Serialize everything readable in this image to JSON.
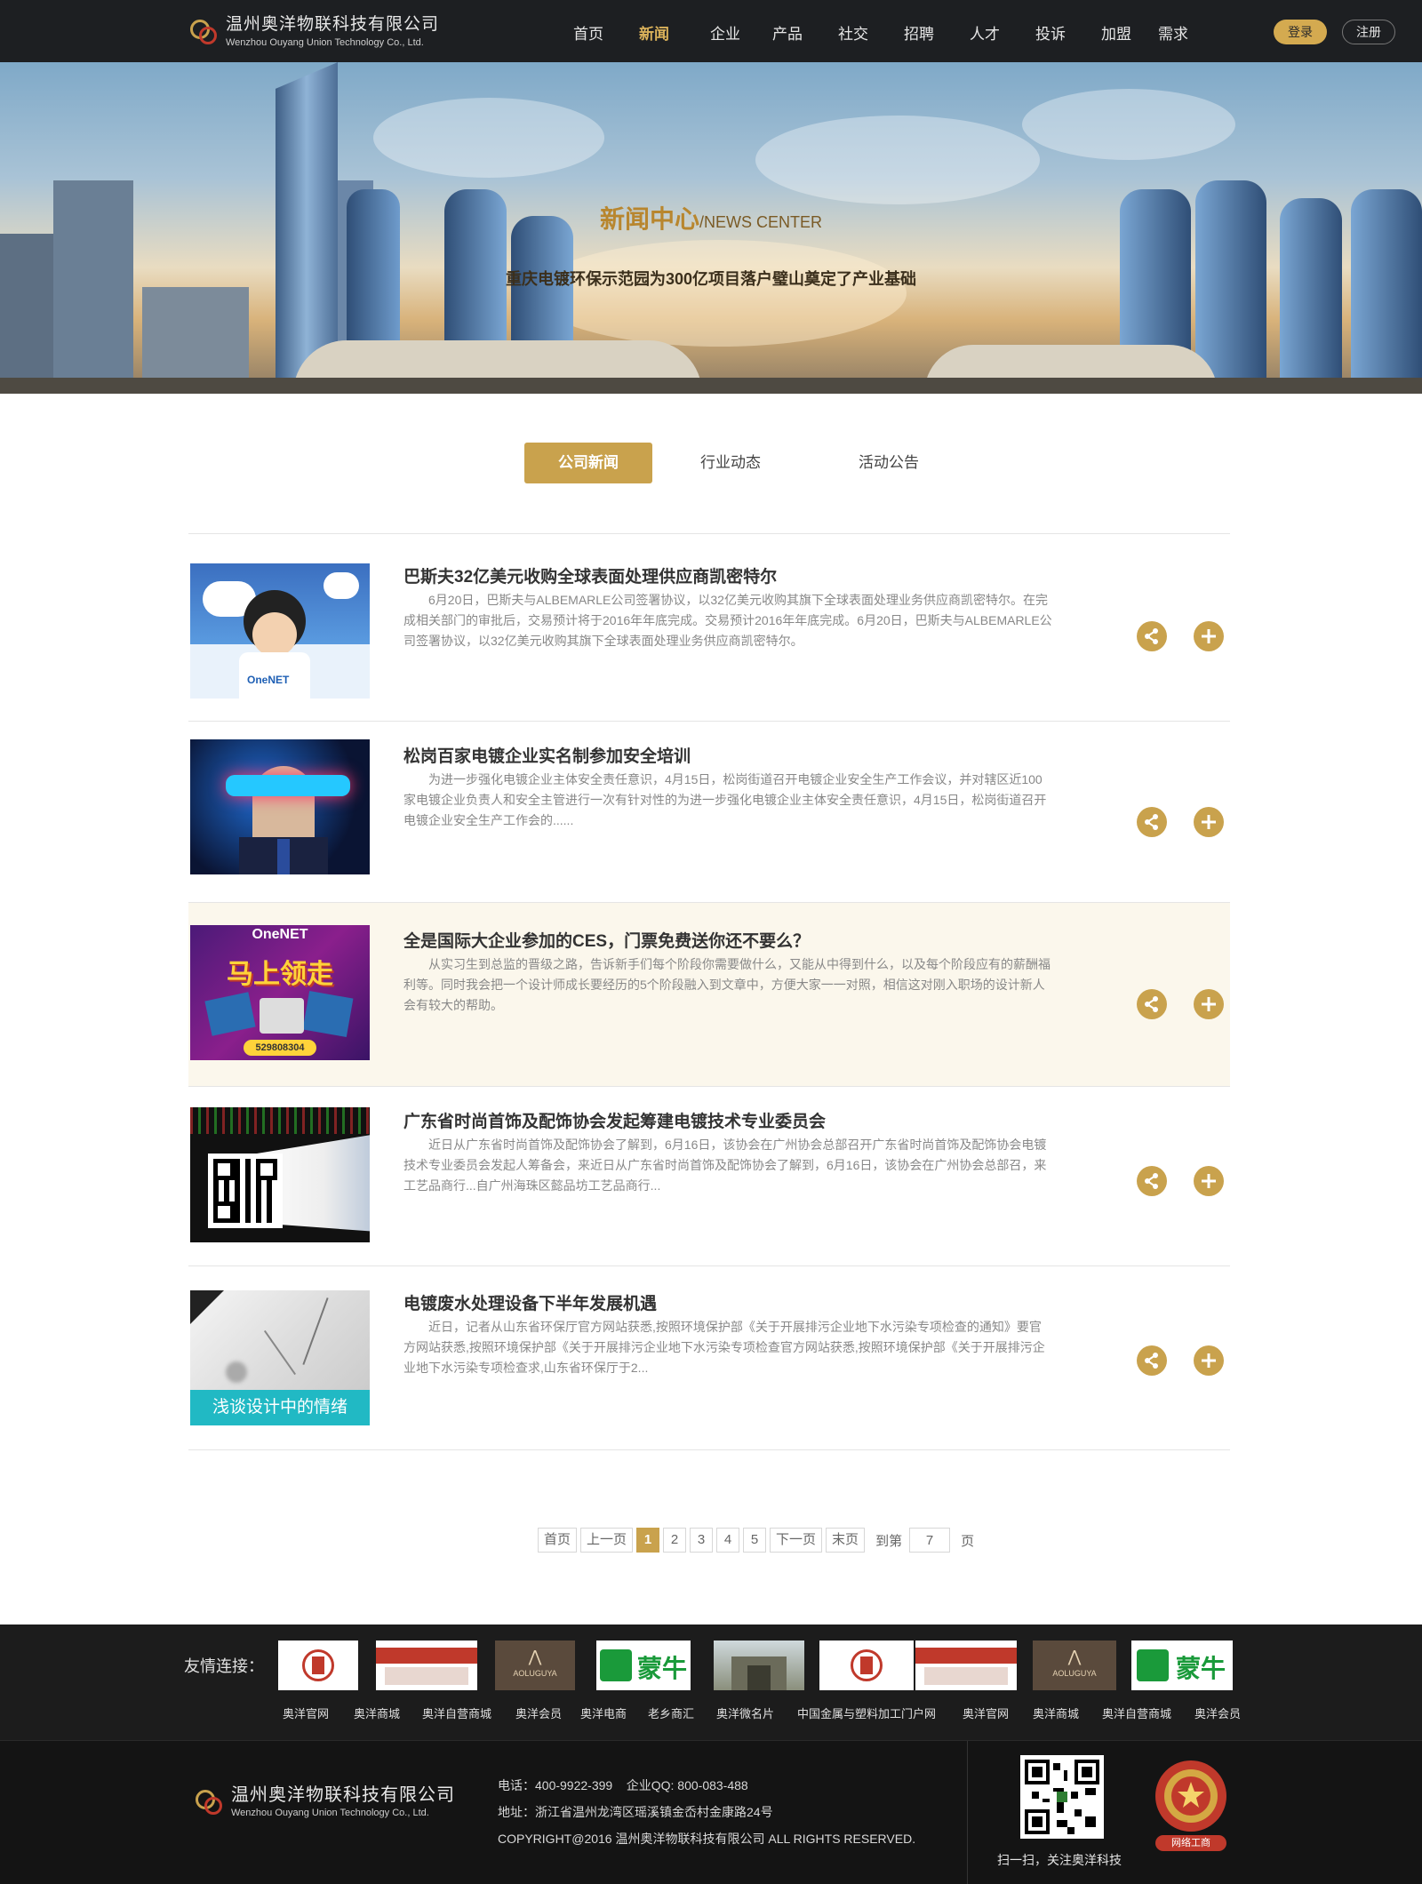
{
  "header": {
    "logo_cn": "温州奥洋物联科技有限公司",
    "logo_en": "Wenzhou Ouyang Union Technology Co., Ltd.",
    "nav": [
      {
        "label": "首页",
        "active": false
      },
      {
        "label": "新闻",
        "active": true
      },
      {
        "label": "企业",
        "active": false
      },
      {
        "label": "产品",
        "active": false
      },
      {
        "label": "社交",
        "active": false
      },
      {
        "label": "招聘",
        "active": false
      },
      {
        "label": "人才",
        "active": false
      },
      {
        "label": "投诉",
        "active": false
      },
      {
        "label": "加盟",
        "active": false
      },
      {
        "label": "需求",
        "active": false
      }
    ],
    "login_label": "登录",
    "register_label": "注册"
  },
  "banner": {
    "title_cn": "新闻中心",
    "title_en": "/NEWS CENTER",
    "subtitle": "重庆电镀环保示范园为300亿项目落户璧山奠定了产业基础"
  },
  "tabs": [
    {
      "label": "公司新闻",
      "active": true
    },
    {
      "label": "行业动态",
      "active": false
    },
    {
      "label": "活动公告",
      "active": false
    }
  ],
  "news": [
    {
      "title": "巴斯夫32亿美元收购全球表面处理供应商凯密特尔",
      "desc": "6月20日，巴斯夫与ALBEMARLE公司签署协议，以32亿美元收购其旗下全球表面处理业务供应商凯密特尔。在完成相关部门的审批后，交易预计将于2016年年底完成。交易预计2016年年底完成。6月20日，巴斯夫与ALBEMARLE公司签署协议，以32亿美元收购其旗下全球表面处理业务供应商凯密特尔。",
      "thumb_text": "OneNET",
      "highlight": false
    },
    {
      "title": "松岗百家电镀企业实名制参加安全培训",
      "desc": "为进一步强化电镀企业主体安全责任意识，4月15日，松岗街道召开电镀企业安全生产工作会议，并对辖区近100家电镀企业负责人和安全主管进行一次有针对性的为进一步强化电镀企业主体安全责任意识，4月15日，松岗街道召开电镀企业安全生产工作会的......",
      "thumb_text": "",
      "highlight": false
    },
    {
      "title": "全是国际大企业参加的CES，门票免费送你还不要么？",
      "desc": "从实习生到总监的晋级之路，告诉新手们每个阶段你需要做什么，又能从中得到什么，以及每个阶段应有的薪酬福利等。同时我会把一个设计师成长要经历的5个阶段融入到文章中，方便大家一一对照，相信这对刚入职场的设计新人会有较大的帮助。",
      "thumb_text": "马上领走",
      "thumb_text2": "OneNET",
      "thumb_text3": "529808304",
      "highlight": true
    },
    {
      "title": "广东省时尚首饰及配饰协会发起筹建电镀技术专业委员会",
      "desc": "近日从广东省时尚首饰及配饰协会了解到，6月16日，该协会在广州协会总部召开广东省时尚首饰及配饰协会电镀技术专业委员会发起人筹备会，来近日从广东省时尚首饰及配饰协会了解到，6月16日，该协会在广州协会总部召，来工艺品商行...自广州海珠区懿品坊工艺品商行...",
      "thumb_text": "",
      "highlight": false
    },
    {
      "title": "电镀废水处理设备下半年发展机遇",
      "desc": "近日，记者从山东省环保厅官方网站获悉,按照环境保护部《关于开展排污企业地下水污染专项检查的通知》要官方网站获悉,按照环境保护部《关于开展排污企业地下水污染专项检查官方网站获悉,按照环境保护部《关于开展排污企业地下水污染专项检查求,山东省环保厅于2...",
      "thumb_text": "浅谈设计中的情绪",
      "highlight": false
    }
  ],
  "pager": {
    "first": "首页",
    "prev": "上一页",
    "pages": [
      "1",
      "2",
      "3",
      "4",
      "5"
    ],
    "current": "1",
    "next": "下一页",
    "last": "末页",
    "goto_label": "到第",
    "goto_value": "7",
    "page_unit": "页"
  },
  "friend_links": {
    "label": "友情连接：",
    "logos": [
      "seal",
      "banner",
      "AOLUGUYA",
      "蒙牛",
      "gate",
      "seal",
      "banner",
      "AOLUGUYA",
      "蒙牛"
    ],
    "names": [
      "奥洋官网",
      "奥洋商城",
      "奥洋自营商城",
      "奥洋会员",
      "奥洋电商",
      "老乡商汇",
      "奥洋微名片",
      "中国金属与塑料加工门户网",
      "奥洋官网",
      "奥洋商城",
      "奥洋自营商城",
      "奥洋会员"
    ]
  },
  "footer": {
    "logo_cn": "温州奥洋物联科技有限公司",
    "logo_en": "Wenzhou Ouyang Union Technology Co., Ltd.",
    "phone": "电话：400-9922-399    企业QQ: 800-083-488",
    "address": "地址：浙江省温州龙湾区瑶溪镇金岙村金康路24号",
    "copyright": "COPYRIGHT@2016 温州奥洋物联科技有限公司 ALL RIGHTS RESERVED.",
    "qr_caption": "扫一扫，关注奥洋科技",
    "badge_label": "网络工商"
  },
  "colors": {
    "accent": "#c9a24d",
    "header_bg": "#1d1f22",
    "footer_bg": "#141414"
  }
}
